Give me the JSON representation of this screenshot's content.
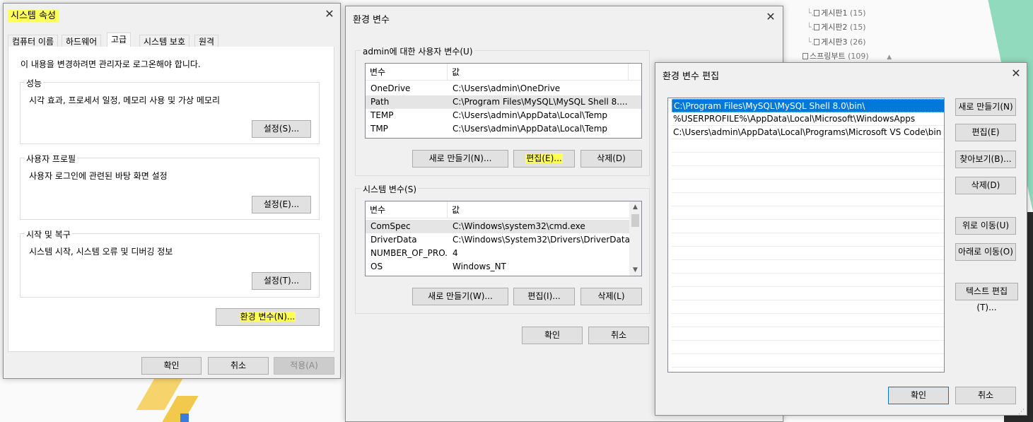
{
  "colors": {
    "highlight": "#ffff5a",
    "selection": "#0078d7",
    "window_bg": "#f0f0f0",
    "button_bg": "#e1e1e1"
  },
  "tree": [
    {
      "label": "게시판1",
      "count": "(15)"
    },
    {
      "label": "게시판2",
      "count": "(15)"
    },
    {
      "label": "게시판3",
      "count": "(26)"
    },
    {
      "label": "스프링부트",
      "count": "(109)"
    }
  ],
  "sysprops": {
    "title": "시스템 속성",
    "tabs": [
      "컴퓨터 이름",
      "하드웨어",
      "고급",
      "시스템 보호",
      "원격"
    ],
    "admin_note": "이 내용을 변경하려면 관리자로 로그온해야 합니다.",
    "performance": {
      "label": "성능",
      "desc": "시각 효과, 프로세서 일정, 메모리 사용 및 가상 메모리",
      "button": "설정(S)..."
    },
    "profile": {
      "label": "사용자 프로필",
      "desc": "사용자 로그인에 관련된 바탕 화면 설정",
      "button": "설정(E)..."
    },
    "startup": {
      "label": "시작 및 복구",
      "desc": "시스템 시작, 시스템 오류 및 디버깅 정보",
      "button": "설정(T)..."
    },
    "env_button": "환경 변수(N)...",
    "ok": "확인",
    "cancel": "취소",
    "apply": "적용(A)"
  },
  "envvars": {
    "title": "환경 변수",
    "user_group": "admin에 대한 사용자 변수(U)",
    "col_var": "변수",
    "col_val": "값",
    "user_rows": [
      {
        "name": "OneDrive",
        "value": "C:\\Users\\admin\\OneDrive"
      },
      {
        "name": "Path",
        "value": "C:\\Program Files\\MySQL\\MySQL Shell 8...."
      },
      {
        "name": "TEMP",
        "value": "C:\\Users\\admin\\AppData\\Local\\Temp"
      },
      {
        "name": "TMP",
        "value": "C:\\Users\\admin\\AppData\\Local\\Temp"
      }
    ],
    "user_new": "새로 만들기(N)...",
    "user_edit": "편집(E)...",
    "user_delete": "삭제(D)",
    "system_group": "시스템 변수(S)",
    "system_rows": [
      {
        "name": "ComSpec",
        "value": "C:\\Windows\\system32\\cmd.exe"
      },
      {
        "name": "DriverData",
        "value": "C:\\Windows\\System32\\Drivers\\DriverData"
      },
      {
        "name": "NUMBER_OF_PRO...",
        "value": "4"
      },
      {
        "name": "OS",
        "value": "Windows_NT"
      }
    ],
    "sys_new": "새로 만들기(W)...",
    "sys_edit": "편집(I)...",
    "sys_delete": "삭제(L)",
    "ok": "확인",
    "cancel": "취소"
  },
  "editenv": {
    "title": "환경 변수 편집",
    "entries": [
      "C:\\Program Files\\MySQL\\MySQL Shell 8.0\\bin\\",
      "%USERPROFILE%\\AppData\\Local\\Microsoft\\WindowsApps",
      "C:\\Users\\admin\\AppData\\Local\\Programs\\Microsoft VS Code\\bin"
    ],
    "new": "새로 만들기(N)",
    "edit": "편집(E)",
    "browse": "찾아보기(B)...",
    "delete": "삭제(D)",
    "move_up": "위로 이동(U)",
    "move_down": "아래로 이동(O)",
    "edit_text": "텍스트 편집(T)...",
    "ok": "확인",
    "cancel": "취소"
  },
  "close_glyph": "✕"
}
